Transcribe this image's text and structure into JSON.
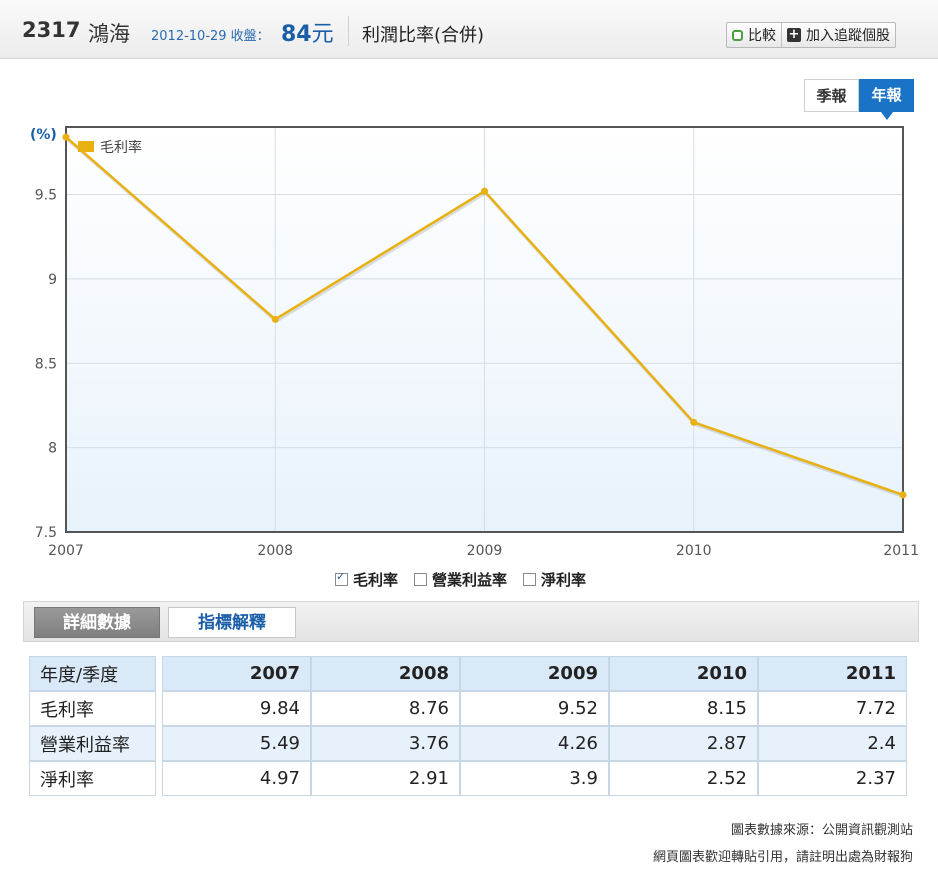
{
  "header": {
    "code": "2317",
    "name": "鴻海",
    "date_label": "2012-10-29 收盤：",
    "price": "84",
    "price_unit": "元",
    "section": "利潤比率(合併)",
    "compare_label": "比較",
    "track_label": "加入追蹤個股"
  },
  "period_tabs": [
    {
      "label": "季報",
      "active": false
    },
    {
      "label": "年報",
      "active": true
    }
  ],
  "chart_data": {
    "type": "line",
    "title": "",
    "ylabel": "(%)",
    "xlabel": "",
    "x": [
      "2007",
      "2008",
      "2009",
      "2010",
      "2011"
    ],
    "yticks": [
      "7.5",
      "8",
      "8.5",
      "9",
      "9.5"
    ],
    "ylim": [
      7.5,
      9.9
    ],
    "grid": true,
    "legend_position": "top-left",
    "series": [
      {
        "name": "毛利率",
        "color": "#e8b111",
        "values": [
          9.84,
          8.76,
          9.52,
          8.15,
          7.72
        ]
      }
    ]
  },
  "series_toggles": [
    {
      "label": "毛利率",
      "checked": true
    },
    {
      "label": "營業利益率",
      "checked": false
    },
    {
      "label": "淨利率",
      "checked": false
    }
  ],
  "detail_tabs": {
    "detail": "詳細數據",
    "explain": "指標解釋"
  },
  "table": {
    "header": "年度/季度",
    "years": [
      "2007",
      "2008",
      "2009",
      "2010",
      "2011"
    ],
    "rows": [
      {
        "label": "毛利率",
        "values": [
          "9.84",
          "8.76",
          "9.52",
          "8.15",
          "7.72"
        ]
      },
      {
        "label": "營業利益率",
        "values": [
          "5.49",
          "3.76",
          "4.26",
          "2.87",
          "2.4"
        ]
      },
      {
        "label": "淨利率",
        "values": [
          "4.97",
          "2.91",
          "3.9",
          "2.52",
          "2.37"
        ]
      }
    ]
  },
  "footer": {
    "source": "圖表數據來源：公開資訊觀測站",
    "note": "網頁圖表歡迎轉貼引用，請註明出處為財報狗"
  }
}
